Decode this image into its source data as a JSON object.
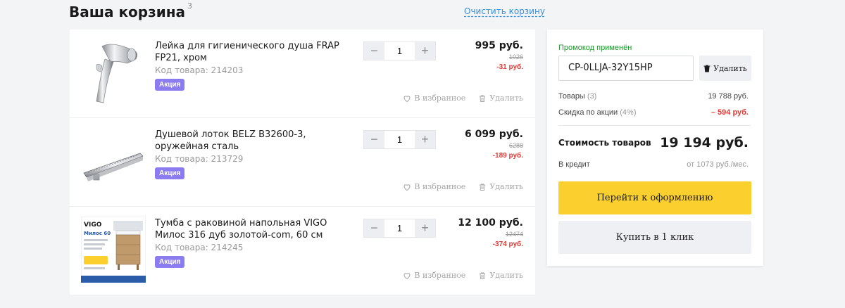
{
  "header": {
    "title": "Ваша корзина",
    "count": "3",
    "clear_label": "Очистить корзину"
  },
  "items": [
    {
      "name": "Лейка для гигиенического душа FRAP FP21, хром",
      "code": "Код товара: 214203",
      "badge": "Акция",
      "quantity": "1",
      "minus": "−",
      "plus": "+",
      "price": "995 руб.",
      "old_price": "1026",
      "discount": "-31 руб.",
      "favorite": "В избранное",
      "delete": "Удалить"
    },
    {
      "name": "Душевой лоток BELZ B32600-3, оружейная сталь",
      "code": "Код товара: 213729",
      "badge": "Акция",
      "quantity": "1",
      "minus": "−",
      "plus": "+",
      "price": "6 099 руб.",
      "old_price": "6288",
      "discount": "-189 руб.",
      "favorite": "В избранное",
      "delete": "Удалить"
    },
    {
      "name": "Тумба с раковиной напольная VIGO Милос 316 дуб золотой-com, 60 см",
      "code": "Код товара: 214245",
      "badge": "Акция",
      "quantity": "1",
      "minus": "−",
      "plus": "+",
      "price": "12 100 руб.",
      "old_price": "12474",
      "discount": "-374 руб.",
      "favorite": "В избранное",
      "delete": "Удалить",
      "image_brand": "VIGO",
      "image_series": "Милос 60"
    }
  ],
  "summary": {
    "promo_label": "Промокод применён",
    "promo_code": "CP-0LLJA-32Y15HP",
    "promo_delete": "Удалить",
    "goods_label": "Товары",
    "goods_count": "(3)",
    "goods_value": "19 788 руб.",
    "discount_label": "Скидка по акции",
    "discount_pct": "(4%)",
    "discount_value": "– 594 руб.",
    "total_label": "Стоимость товаров",
    "total_value": "19 194 руб.",
    "credit_label": "В кредит",
    "credit_value": "от 1073 руб./мес.",
    "checkout_label": "Перейти к оформлению",
    "oneclick_label": "Купить в 1 клик"
  },
  "colors": {
    "accent_yellow": "#fbcf2e",
    "badge_purple": "#8b7cf0",
    "discount_red": "#e53935",
    "promo_green": "#1a9a2c",
    "link_blue": "#3b8fd8"
  }
}
